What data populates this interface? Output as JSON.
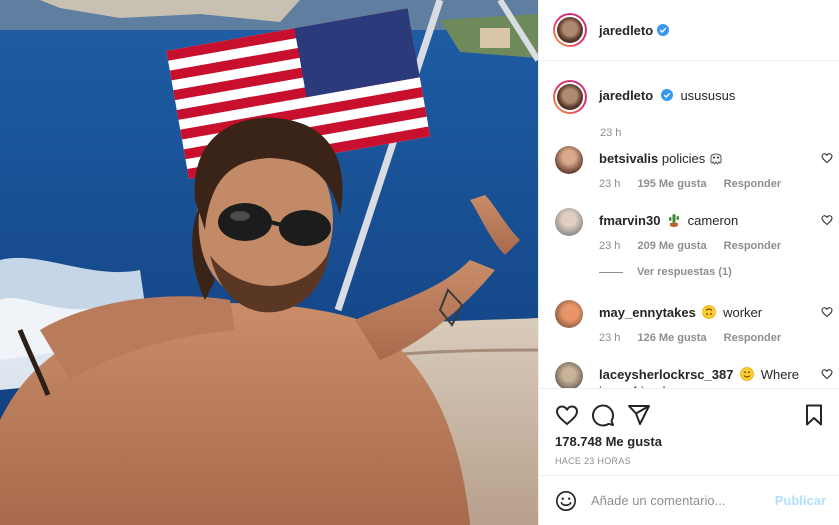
{
  "post": {
    "author": "jaredleto",
    "caption": "usususus",
    "caption_time": "23 h",
    "likes_label": "178.748 Me gusta",
    "time_ago": "HACE 23 HORAS"
  },
  "comments": [
    {
      "user": "betsivalis",
      "text": "policies",
      "emoji": "ghost-emoji",
      "time": "23 h",
      "likes": "195 Me gusta",
      "reply": "Responder"
    },
    {
      "user": "fmarvin30",
      "text": "cameron",
      "emoji": "cactus-emoji",
      "time": "23 h",
      "likes": "209 Me gusta",
      "reply": "Responder"
    },
    {
      "user": "may_ennytakes",
      "text": "worker",
      "emoji": "upside-down-face-emoji",
      "time": "23 h",
      "likes": "126 Me gusta",
      "reply": "Responder"
    },
    {
      "user": "laceysherlockrsc_387",
      "text": "Where is my friends",
      "emoji": "smiling-face-emoji"
    }
  ],
  "view_replies": "Ver respuestas (1)",
  "add_comment": {
    "placeholder": "Añade un comentario...",
    "publish": "Publicar"
  },
  "colors": {
    "verified": "#3897f0",
    "publish_disabled": "#b2dffc",
    "secondary_text": "#8e8e8e"
  },
  "icons": [
    "verified-badge-icon",
    "heart-icon",
    "comment-icon",
    "share-icon",
    "bookmark-icon",
    "emoji-smile-icon"
  ]
}
